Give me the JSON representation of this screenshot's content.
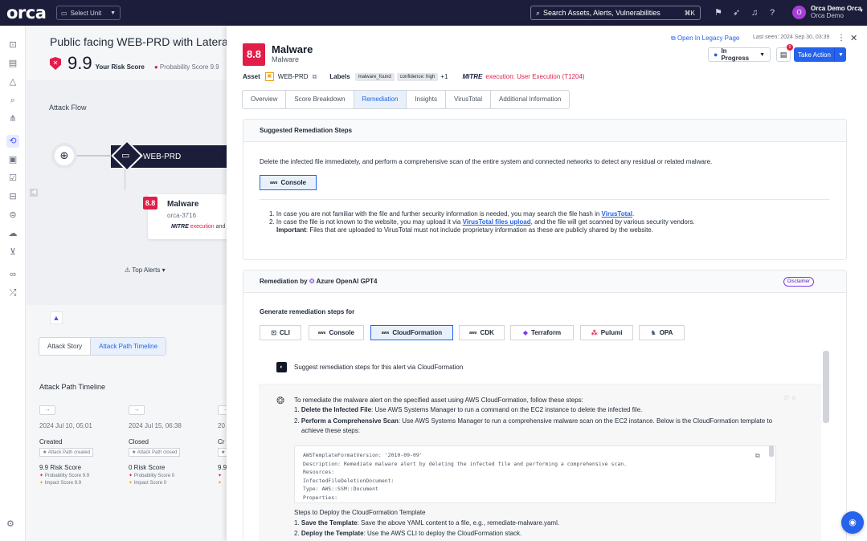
{
  "topbar": {
    "logo": "orca",
    "select_unit": "Select Unit",
    "search_placeholder": "Search Assets, Alerts, Vulnerabilities",
    "search_kbd": "⌘K",
    "user_name": "Orca Demo Orca",
    "user_org": "Orca Demo",
    "avatar_letter": "O"
  },
  "background": {
    "title": "Public facing WEB-PRD with Lateral Mo",
    "risk_score": "9.9",
    "risk_label": "Your Risk Score",
    "probability": "Probability Score 9.9",
    "attack_flow": "Attack Flow",
    "node_web": "WEB-PRD",
    "node_malware_score": "8.8",
    "node_malware": "Malware",
    "node_malware_id": "orca-3716",
    "node_mitre_a": "MITRE",
    "node_mitre_b": "execution",
    "node_mitre_c": "and",
    "top_alerts": "Top Alerts ▾",
    "tab_story": "Attack Story",
    "tab_timeline": "Attack Path Timeline",
    "timeline_title": "Attack Path Timeline",
    "timeline": [
      {
        "date": "2024 Jul 10, 05:01",
        "label": "Created",
        "chip": "Attack Path created",
        "score": "9.9 Risk Score",
        "prob": "Probability Score 9.9",
        "impact": "Impact Score 9.9"
      },
      {
        "date": "2024 Jul 15, 06:38",
        "label": "Closed",
        "chip": "Attack Path closed",
        "score": "0 Risk Score",
        "prob": "Probability Score 0",
        "impact": "Impact Score 0"
      },
      {
        "date": "20",
        "label": "Cr",
        "chip": "",
        "score": "9.9",
        "prob": "",
        "impact": ""
      }
    ]
  },
  "drawer": {
    "score": "8.8",
    "title": "Malware",
    "subtitle": "Malware",
    "legacy_link": "Open In Legacy Page",
    "last_seen": "Last seen: 2024 Sep 30, 03:39",
    "status": "In Progress",
    "comment_count": "0",
    "take_action": "Take Action",
    "asset_label": "Asset",
    "asset_value": "WEB-PRD",
    "labels_label": "Labels",
    "label_chips": [
      "malware_found",
      "confidence: high"
    ],
    "labels_more": "+1",
    "mitre_label": "MITRE",
    "mitre_value": "execution: User Execution (T1204)",
    "tabs": [
      "Overview",
      "Score Breakdown",
      "Remediation",
      "Insights",
      "VirusTotal",
      "Additional Information"
    ],
    "suggested_title": "Suggested Remediation Steps",
    "suggested_desc": "Delete the infected file immediately, and perform a comprehensive scan of the entire system and connected networks to detect any residual or related malware.",
    "console_btn": "Console",
    "aws_tag": "aws",
    "step1_a": "1. In case you are not familiar with the file and further security information is needed, you may search the file hash in ",
    "step1_link": "VirusTotal",
    "step1_b": ".",
    "step2_a": "2. In case the file is not known to the website, you may upload it via ",
    "step2_link": "VirusTotal files upload",
    "step2_b": ", and the file will get scanned by various security vendors.",
    "important_b": "Important",
    "important_t": ": Files that are uploaded to VirusTotal must not include proprietary information as these are publicly shared by the website.",
    "ai_title_a": "Remediation by",
    "ai_title_b": "Azure OpenAI GPT4",
    "disclaimer": "Disclaimer",
    "gen_label": "Generate remediation steps for",
    "gen_buttons": [
      "CLI",
      "Console",
      "CloudFormation",
      "CDK",
      "Terraform",
      "Pulumi",
      "OPA"
    ],
    "question": "Suggest remediation steps for this alert via CloudFormation",
    "answer_intro": "To remediate the malware alert on the specified asset using AWS CloudFormation, follow these steps:",
    "ans1_b": "Delete the Infected File",
    "ans1_t": ": Use AWS Systems Manager to run a command on the EC2 instance to delete the infected file.",
    "ans2_b": "Perform a Comprehensive Scan",
    "ans2_t": ": Use AWS Systems Manager to run a comprehensive malware scan on the EC2 instance. Below is the CloudFormation template to achieve these steps:",
    "code": "AWSTemplateFormatVersion: '2010-09-09'\nDescription: Remediate malware alert by deleting the infected file and performing a comprehensive scan.\nResources:\nInfectedFileDeletionDocument:\nType: AWS::SSM::Document\nProperties:\nDocumentType: Command",
    "deploy_title": "Steps to Deploy the CloudFormation Template",
    "deploy1_b": "Save the Template",
    "deploy1_t": ": Save the above YAML content to a file, e.g., remediate-malware.yaml.",
    "deploy2_b": "Deploy the Template",
    "deploy2_t": ": Use the AWS CLI to deploy the CloudFormation stack."
  },
  "colors": {
    "brand_dark": "#1b1d3a",
    "accent": "#2563eb",
    "critical": "#e11d48"
  }
}
